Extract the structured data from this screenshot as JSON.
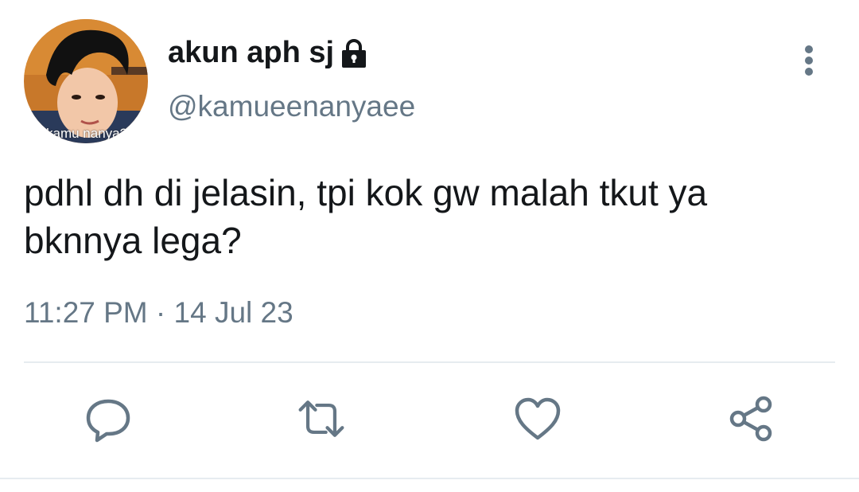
{
  "tweet": {
    "display_name": "akun aph sj",
    "handle": "@kamueenanyaee",
    "avatar_caption": "kamu nanya?",
    "text": "pdhl dh di jelasin, tpi kok gw malah tkut ya bknnya lega?",
    "time": "11:27 PM",
    "separator": "·",
    "date": "14 Jul 23",
    "protected": true
  },
  "icons": {
    "lock": "lock-icon",
    "more": "more-vertical-icon",
    "reply": "reply-icon",
    "retweet": "retweet-icon",
    "like": "like-icon",
    "share": "share-icon"
  },
  "colors": {
    "text_primary": "#14171a",
    "text_secondary": "#657786",
    "icon": "#657786",
    "divider": "#e6ecf0"
  }
}
